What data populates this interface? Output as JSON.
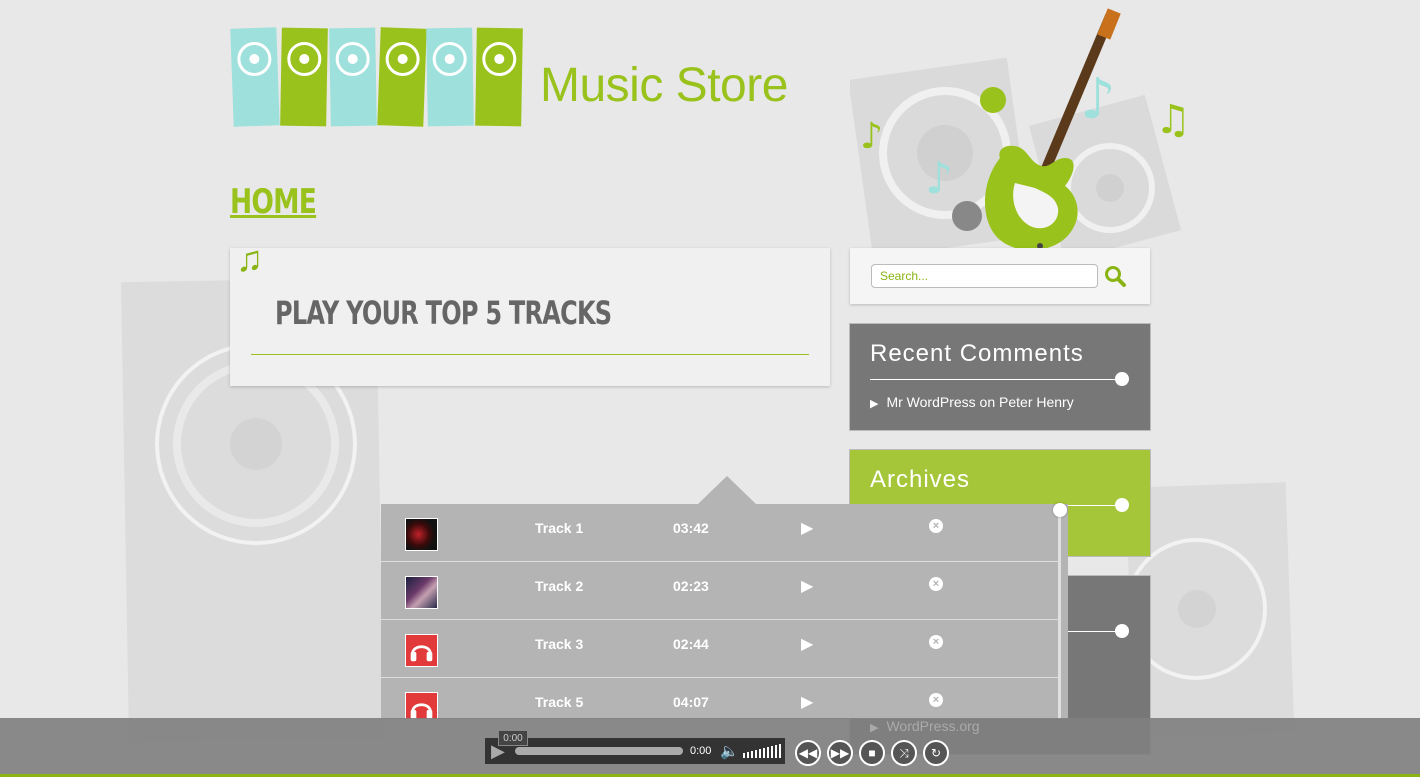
{
  "site": {
    "title": "Music Store",
    "page_title": "HOME",
    "brand_colors": {
      "green": "#9ac21c",
      "teal": "#9ee0dc",
      "gray_widget": "#777777"
    }
  },
  "post": {
    "title": "PLAY YOUR TOP 5 TRACKS",
    "icon": "music-note-icon"
  },
  "search": {
    "placeholder": "Search...",
    "button_icon": "search-icon"
  },
  "widgets": {
    "recent_comments": {
      "title": "Recent Comments",
      "item": "Mr WordPress on Peter Henry"
    },
    "archives": {
      "title": "Archives"
    },
    "meta": {
      "item": "WordPress.org"
    }
  },
  "playlist": {
    "tracks": [
      {
        "name": "Track 1",
        "duration": "03:42",
        "thumb": "album-art-dark-red"
      },
      {
        "name": "Track 2",
        "duration": "02:23",
        "thumb": "album-art-band"
      },
      {
        "name": "Track 3",
        "duration": "02:44",
        "thumb": "headphones-icon"
      },
      {
        "name": "Track 5",
        "duration": "04:07",
        "thumb": "headphones-icon"
      }
    ]
  },
  "player": {
    "tooltip_time": "0:00",
    "current_time": "0:00",
    "controls": [
      "rewind-icon",
      "fast-forward-icon",
      "stop-icon",
      "shuffle-icon",
      "repeat-icon"
    ]
  }
}
